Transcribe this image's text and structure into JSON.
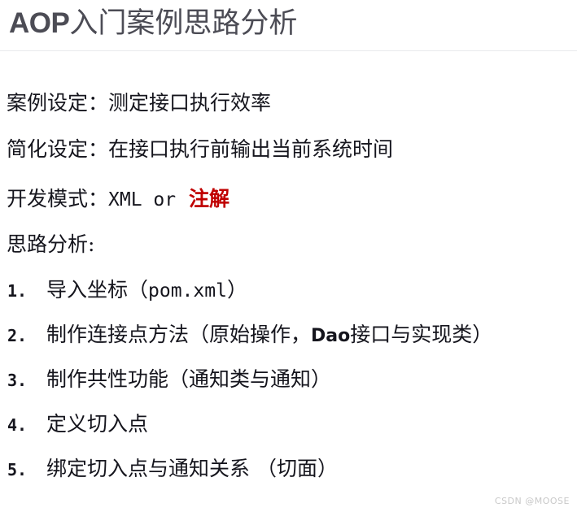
{
  "colors": {
    "background": "#ffffff",
    "title": "#4c4c55",
    "body_text": "#15151d",
    "accent_red": "#c00000",
    "rule": "#e8eaec",
    "watermark": "#c9c9c9"
  },
  "title": {
    "latin": "AOP",
    "cjk": "入门案例思路分析",
    "full": "AOP入门案例思路分析"
  },
  "paragraphs": [
    {
      "label": "案例设定：",
      "value": "测定接口执行效率"
    },
    {
      "label": "简化设定：",
      "value": "在接口执行前输出当前系统时间"
    },
    {
      "label": "开发模式：",
      "mono": "XML or",
      "accent": "注解"
    },
    {
      "label": "思路分析:",
      "value": ""
    }
  ],
  "steps": [
    {
      "num": "1.",
      "prefix": "导入坐标（",
      "mono": "pom.xml",
      "suffix": "）",
      "full": "导入坐标（pom.xml）"
    },
    {
      "num": "2.",
      "prefix": "制作连接点方法（原始操作，",
      "bold": "Dao",
      "suffix": "接口与实现类）",
      "full": "制作连接点方法（原始操作，Dao接口与实现类）"
    },
    {
      "num": "3.",
      "prefix": "制作共性功能（通知类与通知）",
      "bold": "",
      "suffix": "",
      "full": "制作共性功能（通知类与通知）"
    },
    {
      "num": "4.",
      "prefix": "定义切入点",
      "bold": "",
      "suffix": "",
      "full": "定义切入点"
    },
    {
      "num": "5.",
      "prefix": "绑定切入点与通知关系 （切面）",
      "bold": "",
      "suffix": "",
      "full": "绑定切入点与通知关系 （切面）"
    }
  ],
  "watermark": "CSDN @MOOSE"
}
